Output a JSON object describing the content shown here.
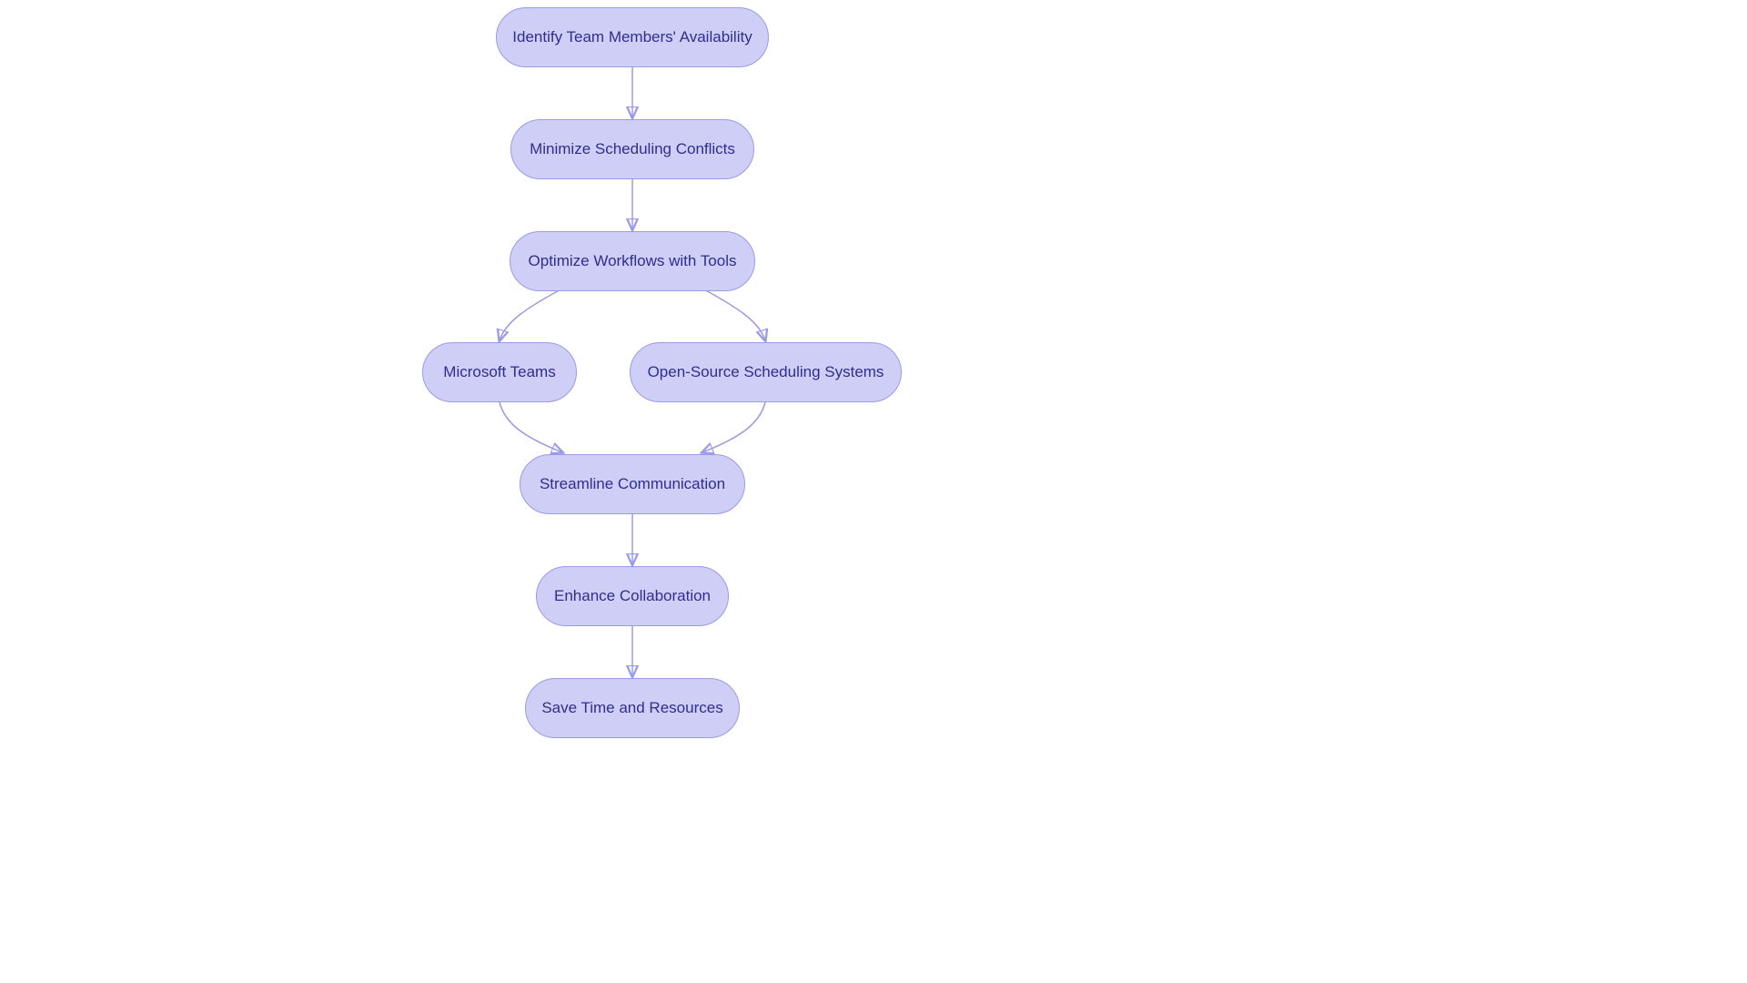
{
  "chart_data": {
    "type": "flowchart",
    "nodes": [
      {
        "id": "n1",
        "label": "Identify Team Members' Availability"
      },
      {
        "id": "n2",
        "label": "Minimize Scheduling Conflicts"
      },
      {
        "id": "n3",
        "label": "Optimize Workflows with Tools"
      },
      {
        "id": "n4",
        "label": "Microsoft Teams"
      },
      {
        "id": "n5",
        "label": "Open-Source Scheduling Systems"
      },
      {
        "id": "n6",
        "label": "Streamline Communication"
      },
      {
        "id": "n7",
        "label": "Enhance Collaboration"
      },
      {
        "id": "n8",
        "label": "Save Time and Resources"
      }
    ],
    "edges": [
      {
        "from": "n1",
        "to": "n2"
      },
      {
        "from": "n2",
        "to": "n3"
      },
      {
        "from": "n3",
        "to": "n4"
      },
      {
        "from": "n3",
        "to": "n5"
      },
      {
        "from": "n4",
        "to": "n6"
      },
      {
        "from": "n5",
        "to": "n6"
      },
      {
        "from": "n6",
        "to": "n7"
      },
      {
        "from": "n7",
        "to": "n8"
      }
    ]
  },
  "nodes": {
    "n1": {
      "label": "Identify Team Members' Availability"
    },
    "n2": {
      "label": "Minimize Scheduling Conflicts"
    },
    "n3": {
      "label": "Optimize Workflows with Tools"
    },
    "n4": {
      "label": "Microsoft Teams"
    },
    "n5": {
      "label": "Open-Source Scheduling Systems"
    },
    "n6": {
      "label": "Streamline Communication"
    },
    "n7": {
      "label": "Enhance Collaboration"
    },
    "n8": {
      "label": "Save Time and Resources"
    }
  },
  "colors": {
    "node_fill": "#cfcef6",
    "node_border": "#9a9ae8",
    "node_text": "#2e2e8f",
    "edge": "#9a9ae8"
  }
}
